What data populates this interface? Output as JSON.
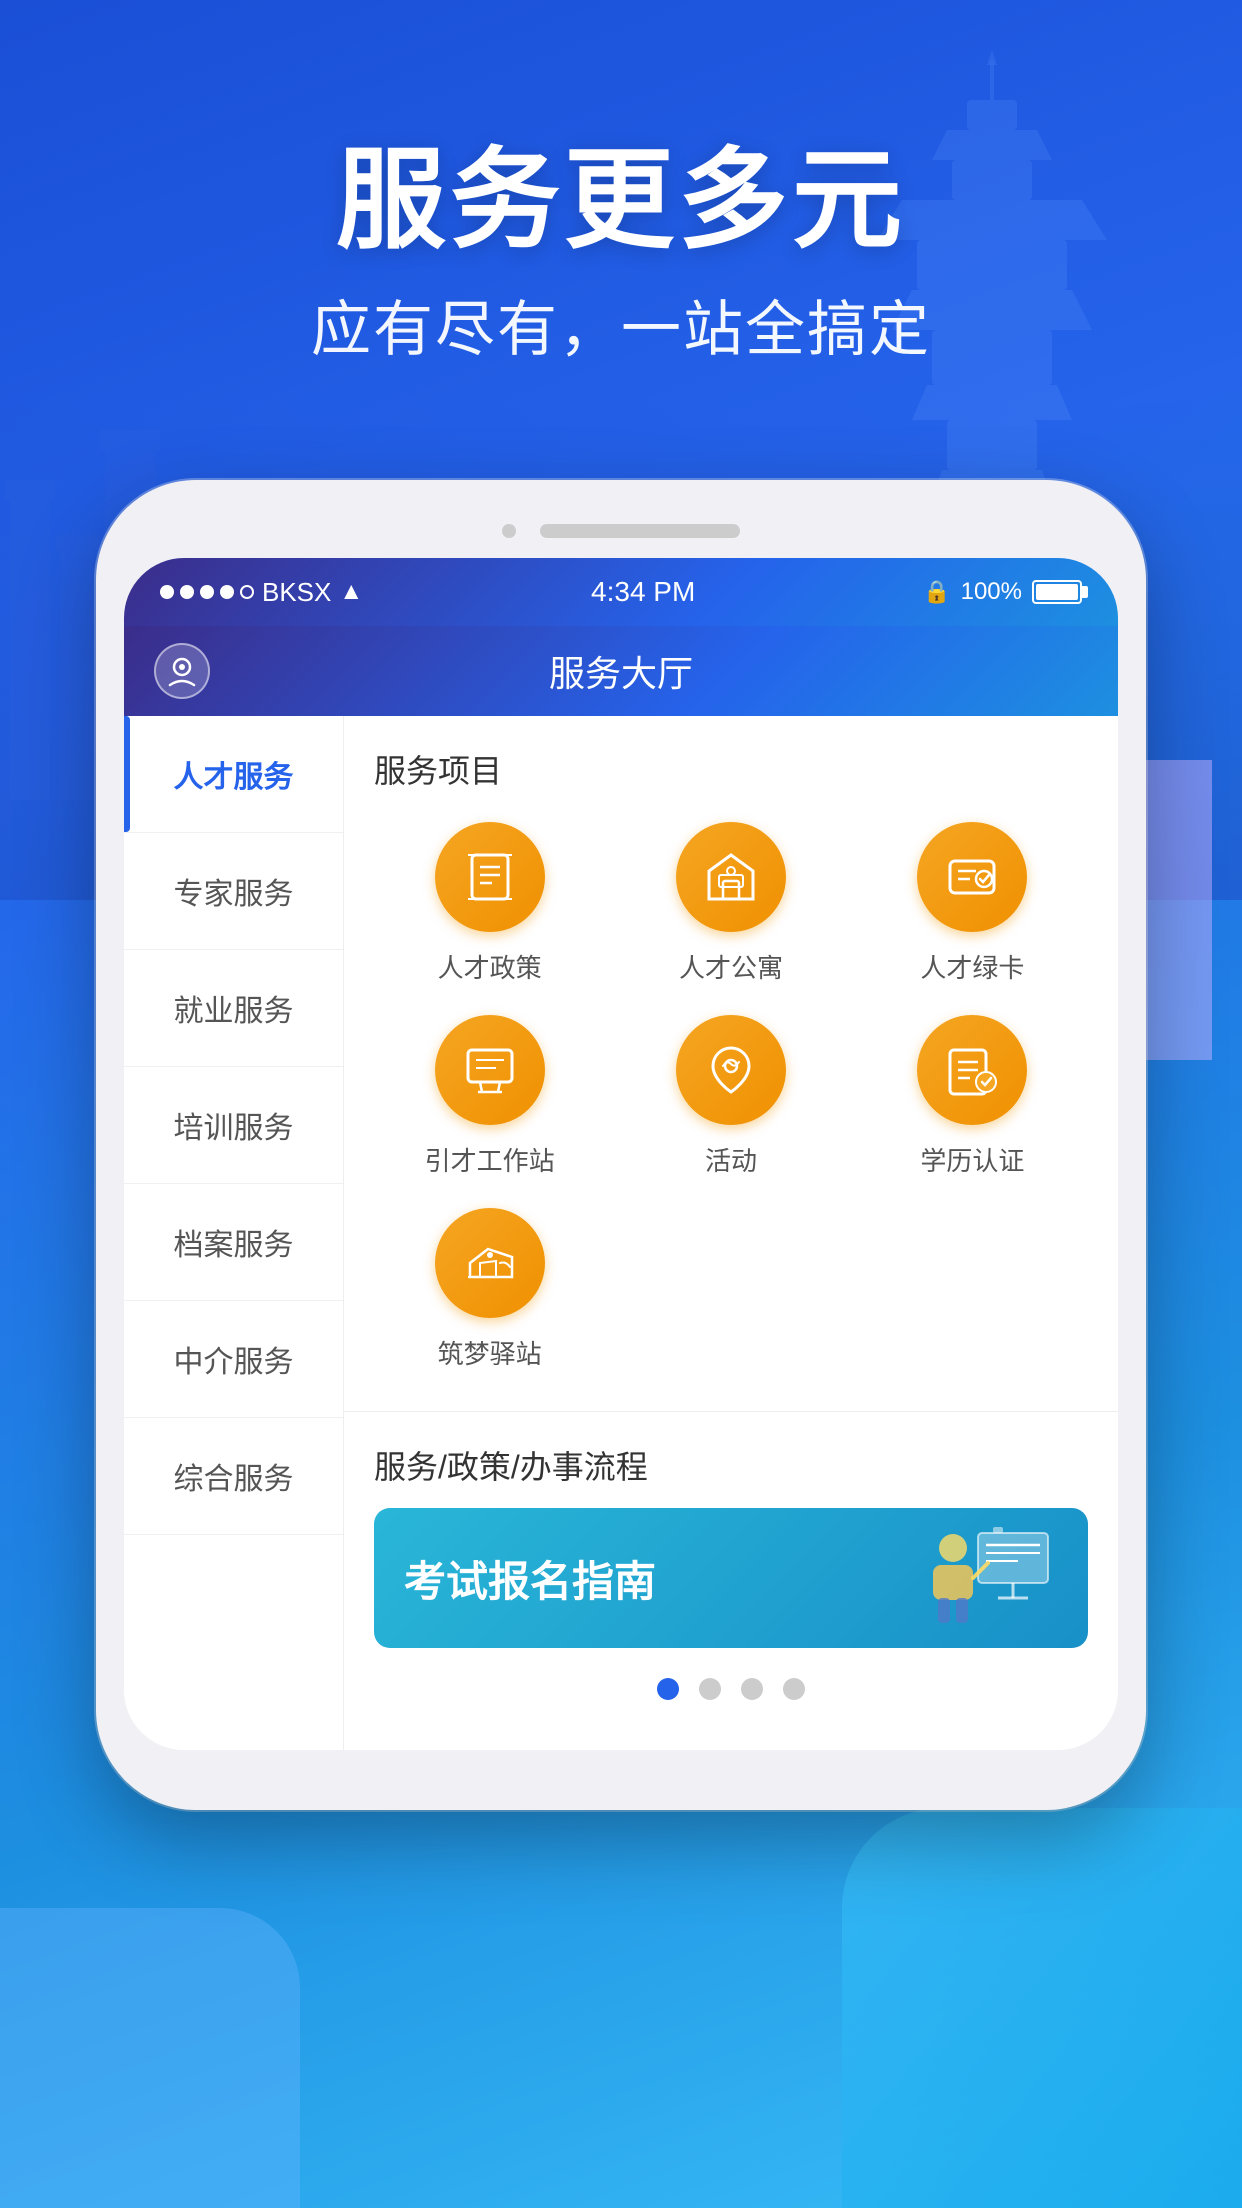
{
  "hero": {
    "title": "服务更多元",
    "subtitle": "应有尽有，一站全搞定"
  },
  "status_bar": {
    "carrier": "BKSX",
    "time": "4:34 PM",
    "battery": "100%"
  },
  "header": {
    "title": "服务大厅"
  },
  "sidebar": {
    "items": [
      {
        "label": "人才服务",
        "active": true
      },
      {
        "label": "专家服务",
        "active": false
      },
      {
        "label": "就业服务",
        "active": false
      },
      {
        "label": "培训服务",
        "active": false
      },
      {
        "label": "档案服务",
        "active": false
      },
      {
        "label": "中介服务",
        "active": false
      },
      {
        "label": "综合服务",
        "active": false
      }
    ]
  },
  "content": {
    "section1_title": "服务项目",
    "services": [
      {
        "label": "人才政策",
        "icon": "📋"
      },
      {
        "label": "人才公寓",
        "icon": "🏠"
      },
      {
        "label": "人才绿卡",
        "icon": "📄"
      },
      {
        "label": "引才工作站",
        "icon": "🖥️"
      },
      {
        "label": "活动",
        "icon": "🗺️"
      },
      {
        "label": "学历认证",
        "icon": "🎓"
      },
      {
        "label": "筑梦驿站",
        "icon": "✈️"
      }
    ],
    "section2_title": "服务/政策/办事流程",
    "guide_banner_text": "考试报名指南",
    "pagination_dots": [
      true,
      false,
      false,
      false
    ]
  }
}
